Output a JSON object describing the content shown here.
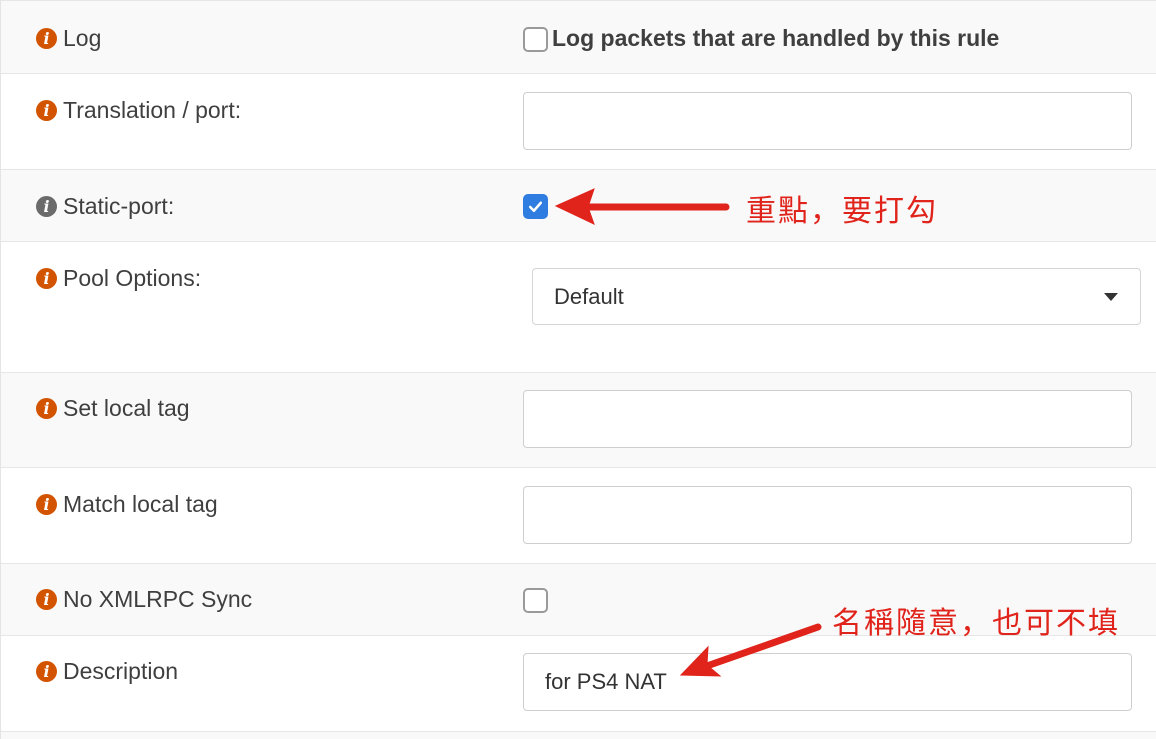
{
  "rows": {
    "log": {
      "label": "Log",
      "checkbox_label": "Log packets that are handled by this rule",
      "checked": false
    },
    "translation_port": {
      "label": "Translation / port:",
      "value": ""
    },
    "static_port": {
      "label": "Static-port:",
      "checked": true
    },
    "pool_options": {
      "label": "Pool Options:",
      "selected": "Default"
    },
    "set_local_tag": {
      "label": "Set local tag",
      "value": ""
    },
    "match_local_tag": {
      "label": "Match local tag",
      "value": ""
    },
    "no_xmlrpc_sync": {
      "label": "No XMLRPC Sync",
      "checked": false
    },
    "description": {
      "label": "Description",
      "value": "for PS4 NAT"
    }
  },
  "annotations": {
    "static_port_note": "重點，要打勾",
    "description_note": "名稱隨意，也可不填"
  },
  "icons": {
    "info": "info-circle-icon",
    "check": "check-icon",
    "caret": "caret-down-icon",
    "arrow": "red-arrow-icon"
  },
  "colors": {
    "info_icon": "#d35400",
    "info_icon_inactive": "#6b6b6b",
    "checkbox_checked": "#2f7de1",
    "annotation": "#e0241b",
    "row_alt_bg": "#f9f9f9"
  }
}
